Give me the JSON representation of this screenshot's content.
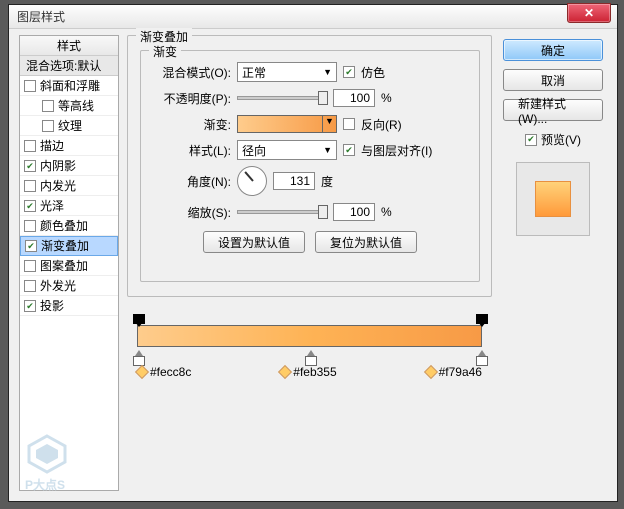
{
  "window": {
    "title": "图层样式"
  },
  "left": {
    "head": "样式",
    "sub": "混合选项:默认",
    "items": [
      {
        "label": "斜面和浮雕",
        "checked": false,
        "indent": false
      },
      {
        "label": "等高线",
        "checked": false,
        "indent": true
      },
      {
        "label": "纹理",
        "checked": false,
        "indent": true
      },
      {
        "label": "描边",
        "checked": false,
        "indent": false
      },
      {
        "label": "内阴影",
        "checked": true,
        "indent": false
      },
      {
        "label": "内发光",
        "checked": false,
        "indent": false
      },
      {
        "label": "光泽",
        "checked": true,
        "indent": false
      },
      {
        "label": "颜色叠加",
        "checked": false,
        "indent": false
      },
      {
        "label": "渐变叠加",
        "checked": true,
        "indent": false,
        "selected": true
      },
      {
        "label": "图案叠加",
        "checked": false,
        "indent": false
      },
      {
        "label": "外发光",
        "checked": false,
        "indent": false
      },
      {
        "label": "投影",
        "checked": true,
        "indent": false
      }
    ]
  },
  "group": {
    "outer_title": "渐变叠加",
    "inner_title": "渐变",
    "blend_label": "混合模式(O):",
    "blend_value": "正常",
    "dither_label": "仿色",
    "dither_checked": true,
    "opacity_label": "不透明度(P):",
    "opacity_value": "100",
    "pct": "%",
    "grad_label": "渐变:",
    "reverse_label": "反向(R)",
    "reverse_checked": false,
    "style_label": "样式(L):",
    "style_value": "径向",
    "align_label": "与图层对齐(I)",
    "align_checked": true,
    "angle_label": "角度(N):",
    "angle_value": "131",
    "angle_unit": "度",
    "scale_label": "缩放(S):",
    "scale_value": "100",
    "btn_default": "设置为默认值",
    "btn_reset": "复位为默认值"
  },
  "stops": {
    "c1": "#fecc8c",
    "c2": "#feb355",
    "c3": "#f79a46"
  },
  "right": {
    "ok": "确定",
    "cancel": "取消",
    "newstyle": "新建样式(W)...",
    "preview_label": "预览(V)",
    "preview_checked": true
  },
  "brand": "P大点S"
}
